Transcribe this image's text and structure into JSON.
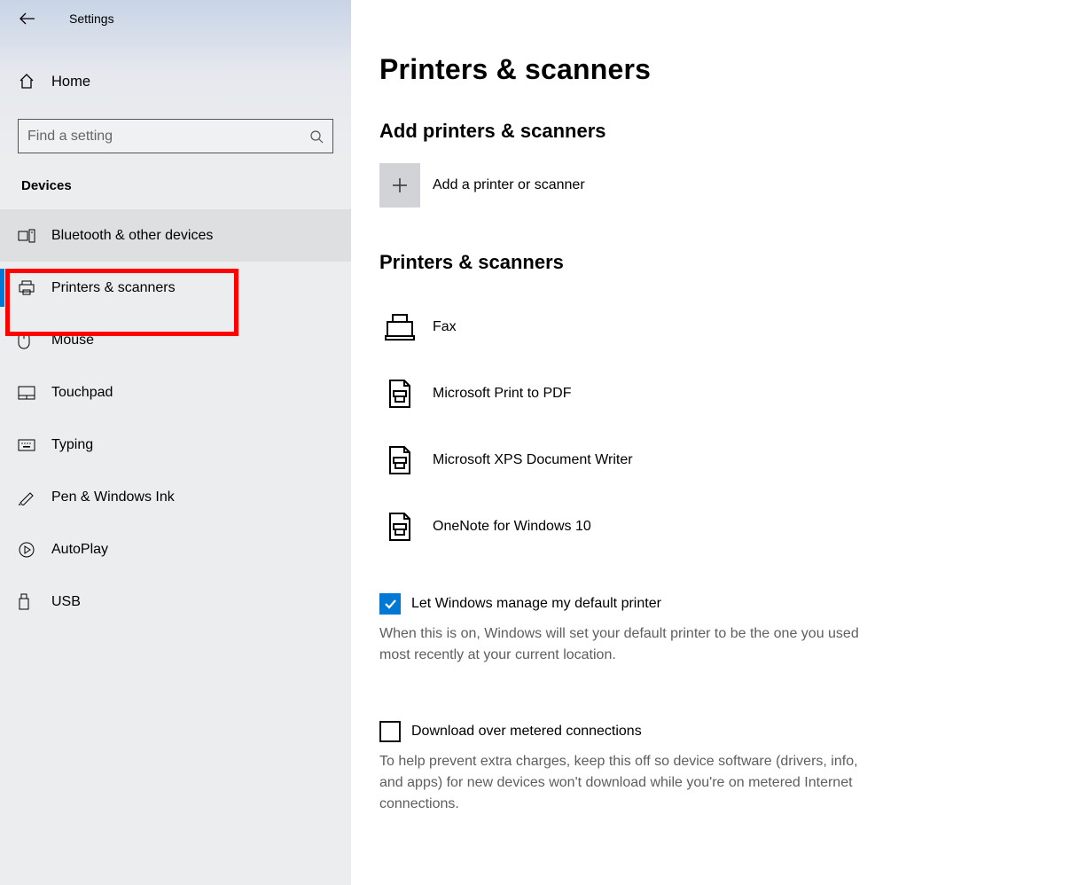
{
  "app_title": "Settings",
  "home_label": "Home",
  "search_placeholder": "Find a setting",
  "section_label": "Devices",
  "nav": [
    {
      "label": "Bluetooth & other devices",
      "icon": "bluetooth-devices"
    },
    {
      "label": "Printers & scanners",
      "icon": "printer"
    },
    {
      "label": "Mouse",
      "icon": "mouse"
    },
    {
      "label": "Touchpad",
      "icon": "touchpad"
    },
    {
      "label": "Typing",
      "icon": "keyboard"
    },
    {
      "label": "Pen & Windows Ink",
      "icon": "pen"
    },
    {
      "label": "AutoPlay",
      "icon": "autoplay"
    },
    {
      "label": "USB",
      "icon": "usb"
    }
  ],
  "page_title": "Printers & scanners",
  "add_section_title": "Add printers & scanners",
  "add_button_label": "Add a printer or scanner",
  "devices_section_title": "Printers & scanners",
  "devices": [
    {
      "label": "Fax",
      "icon": "fax"
    },
    {
      "label": "Microsoft Print to PDF",
      "icon": "doc-printer"
    },
    {
      "label": "Microsoft XPS Document Writer",
      "icon": "doc-printer"
    },
    {
      "label": "OneNote for Windows 10",
      "icon": "doc-printer"
    }
  ],
  "default_printer": {
    "label": "Let Windows manage my default printer",
    "description": "When this is on, Windows will set your default printer to be the one you used most recently at your current location.",
    "checked": true
  },
  "metered": {
    "label": "Download over metered connections",
    "description": "To help prevent extra charges, keep this off so device software (drivers, info, and apps) for new devices won't download while you're on metered Internet connections.",
    "checked": false
  }
}
